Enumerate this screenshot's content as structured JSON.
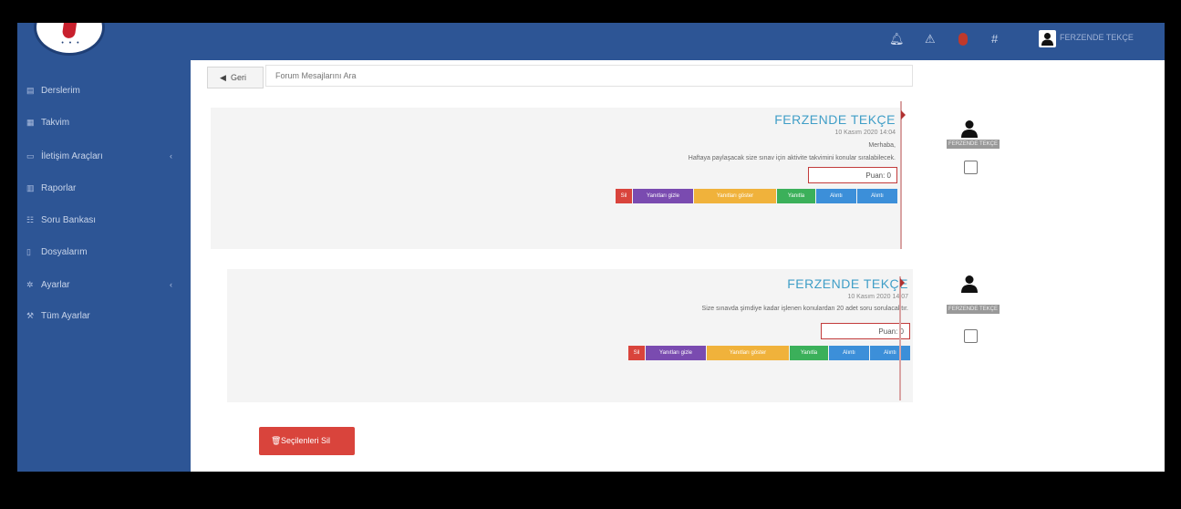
{
  "header": {
    "user_name": "FERZENDE TEKÇE",
    "icons": [
      "bell-icon",
      "warning-icon",
      "flag-icon",
      "hash-icon",
      "user-icon"
    ]
  },
  "sidebar": {
    "items": [
      {
        "label": "Derslerim",
        "icon": "book-icon"
      },
      {
        "label": "Takvim",
        "icon": "calendar-icon"
      },
      {
        "label": "İletişim Araçları",
        "icon": "comment-icon",
        "has_children": true
      },
      {
        "label": "Raporlar",
        "icon": "chart-icon"
      },
      {
        "label": "Soru Bankası",
        "icon": "database-icon"
      },
      {
        "label": "Dosyalarım",
        "icon": "file-icon"
      },
      {
        "label": "Ayarlar",
        "icon": "cog-icon",
        "has_children": true
      },
      {
        "label": "Tüm Ayarlar",
        "icon": "wrench-icon"
      }
    ]
  },
  "toolbar": {
    "back_label": "Geri",
    "search_placeholder": "Forum Mesajlarını Ara"
  },
  "messages": [
    {
      "author": "FERZENDE TEKÇE",
      "date": "10 Kasım 2020 14:04",
      "greeting": "Merhaba,",
      "body": "Haftaya paylaşacak size sınav için aktivite takvimini konular sıralabilecek.",
      "score_label": "Puan: 0",
      "buttons": [
        "Sil",
        "Yanıtları gizle",
        "Yanıtları göster",
        "Yanıtla",
        "Alıntı",
        "Alıntı"
      ],
      "avatar_tag": "FERZENDE TEKÇE"
    },
    {
      "author": "FERZENDE TEKÇE",
      "date": "10 Kasım 2020 14:07",
      "body": "Size sınavda şimdiye kadar işlenen konulardan 20 adet soru sorulacaktır.",
      "score_label": "Puan: 0",
      "buttons": [
        "Sil",
        "Yanıtları gizle",
        "Yanıtları göster",
        "Yanıtla",
        "Alıntı",
        "Alıntı"
      ],
      "avatar_tag": "FERZENDE TEKÇE"
    }
  ],
  "actions": {
    "delete_selected_label": "Seçilenleri Sil"
  },
  "colors": {
    "brand": "#2d5595",
    "accent_red": "#d9443c",
    "author_blue": "#3f9ec7"
  }
}
